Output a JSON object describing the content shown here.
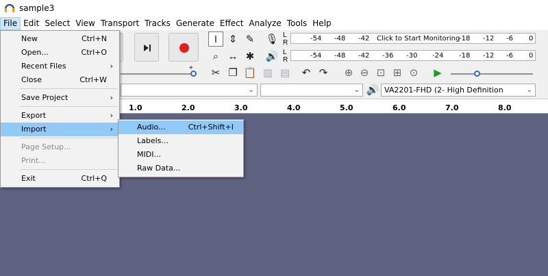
{
  "window": {
    "title": "sample3"
  },
  "menubar": [
    "File",
    "Edit",
    "Select",
    "View",
    "Transport",
    "Tracks",
    "Generate",
    "Effect",
    "Analyze",
    "Tools",
    "Help"
  ],
  "file_menu": {
    "items": [
      {
        "label": "New",
        "shortcut": "Ctrl+N",
        "submenu": false,
        "disabled": false
      },
      {
        "label": "Open...",
        "shortcut": "Ctrl+O",
        "submenu": false,
        "disabled": false
      },
      {
        "label": "Recent Files",
        "shortcut": "",
        "submenu": true,
        "disabled": false
      },
      {
        "label": "Close",
        "shortcut": "Ctrl+W",
        "submenu": false,
        "disabled": false
      },
      {
        "label": "Save Project",
        "shortcut": "",
        "submenu": true,
        "disabled": false
      },
      {
        "label": "Export",
        "shortcut": "",
        "submenu": true,
        "disabled": false
      },
      {
        "label": "Import",
        "shortcut": "",
        "submenu": true,
        "disabled": false
      },
      {
        "label": "Page Setup...",
        "shortcut": "",
        "submenu": false,
        "disabled": true
      },
      {
        "label": "Print...",
        "shortcut": "",
        "submenu": false,
        "disabled": true
      },
      {
        "label": "Exit",
        "shortcut": "Ctrl+Q",
        "submenu": false,
        "disabled": false
      }
    ]
  },
  "import_menu": {
    "items": [
      {
        "label": "Audio...",
        "shortcut": "Ctrl+Shift+I"
      },
      {
        "label": "Labels...",
        "shortcut": ""
      },
      {
        "label": "MIDI...",
        "shortcut": ""
      },
      {
        "label": "Raw Data...",
        "shortcut": ""
      }
    ]
  },
  "meters": {
    "record_scale": [
      "-54",
      "-48",
      "-42",
      "-18",
      "-12",
      "-6",
      "0"
    ],
    "monitor_prompt": "Click to Start Monitoring",
    "playback_scale": [
      "-54",
      "-48",
      "-42",
      "-36",
      "-30",
      "-24",
      "-18",
      "-12",
      "-6",
      "0"
    ],
    "channel_l": "L",
    "channel_r": "R"
  },
  "device": {
    "playback_device": "VA2201-FHD (2- High Definition"
  },
  "slider": {
    "plus": "+"
  },
  "ruler": [
    "1.0",
    "2.0",
    "3.0",
    "4.0",
    "5.0",
    "6.0",
    "7.0",
    "8.0"
  ],
  "colors": {
    "accent": "#91c9f7",
    "workspace": "#5f6280",
    "record": "#e02020",
    "play": "#20a020"
  }
}
